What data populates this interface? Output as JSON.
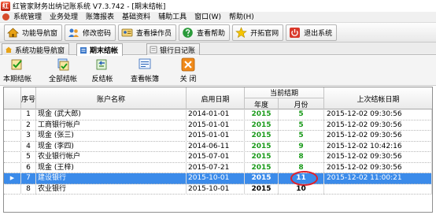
{
  "window": {
    "title": "红管家财务出纳记账系统 V7.3.742 - [期末结帐]",
    "icon_letter": "红"
  },
  "menu": [
    "系统管理",
    "业务处理",
    "账簿报表",
    "基础资料",
    "辅助工具",
    "窗口(W)",
    "帮助(H)"
  ],
  "toolbar": [
    {
      "label": "功能导航窗",
      "icon": "house-icon"
    },
    {
      "label": "修改密码",
      "icon": "users-icon"
    },
    {
      "label": "查看操作员",
      "icon": "operator-card-icon"
    },
    {
      "label": "查看帮助",
      "icon": "help-icon"
    },
    {
      "label": "开拓官网",
      "icon": "star-icon"
    },
    {
      "label": "退出系统",
      "icon": "power-icon"
    }
  ],
  "tabs": [
    {
      "label": "系统功能导航窗",
      "active": false
    },
    {
      "label": "期末结帐",
      "active": true
    },
    {
      "label": "银行日记账",
      "active": false
    }
  ],
  "actions": [
    {
      "label": "本期结帐",
      "icon": "close-period-icon"
    },
    {
      "label": "全部结帐",
      "icon": "close-all-icon"
    },
    {
      "label": "反结帐",
      "icon": "reverse-close-icon"
    },
    {
      "label": "查看帐簿",
      "icon": "view-ledger-icon"
    },
    {
      "label": "关 闭",
      "icon": "close-icon"
    }
  ],
  "grid": {
    "headers": {
      "index": "序号",
      "name": "账户名称",
      "start_date": "启用日期",
      "current_period": "当前结期",
      "year": "年度",
      "month": "月份",
      "last_close": "上次结帐日期"
    },
    "rows": [
      {
        "no": "1",
        "name": "现金 (武大郎)",
        "start_date": "2014-01-01",
        "year": "2015",
        "month": "5",
        "last_close": "2015-12-02 09:30:56"
      },
      {
        "no": "2",
        "name": "工商银行帐户",
        "start_date": "2015-01-01",
        "year": "2015",
        "month": "5",
        "last_close": "2015-12-02 09:30:56"
      },
      {
        "no": "3",
        "name": "现金 (张三)",
        "start_date": "2015-01-01",
        "year": "2015",
        "month": "5",
        "last_close": "2015-12-02 09:30:56"
      },
      {
        "no": "4",
        "name": "现金 (李四)",
        "start_date": "2014-06-11",
        "year": "2015",
        "month": "9",
        "last_close": "2015-12-02 10:42:16"
      },
      {
        "no": "5",
        "name": "农业银行帐户",
        "start_date": "2015-07-01",
        "year": "2015",
        "month": "8",
        "last_close": "2015-12-02 09:30:56"
      },
      {
        "no": "6",
        "name": "现金 (王梓)",
        "start_date": "2015-07-21",
        "year": "2015",
        "month": "8",
        "last_close": "2015-12-02 09:30:56"
      },
      {
        "no": "7",
        "name": "建设银行",
        "start_date": "2015-10-01",
        "year": "2015",
        "month": "11",
        "last_close": "2015-12-02 11:00:21",
        "selected": true
      },
      {
        "no": "8",
        "name": "农业银行",
        "start_date": "2015-10-01",
        "year": "2015",
        "month": "10",
        "last_close": ""
      }
    ],
    "selected_pointer": "▶"
  },
  "colors": {
    "selected_row": "#3b8bea",
    "period_green": "#1a9a1a",
    "highlight_circle": "#e0202a"
  }
}
